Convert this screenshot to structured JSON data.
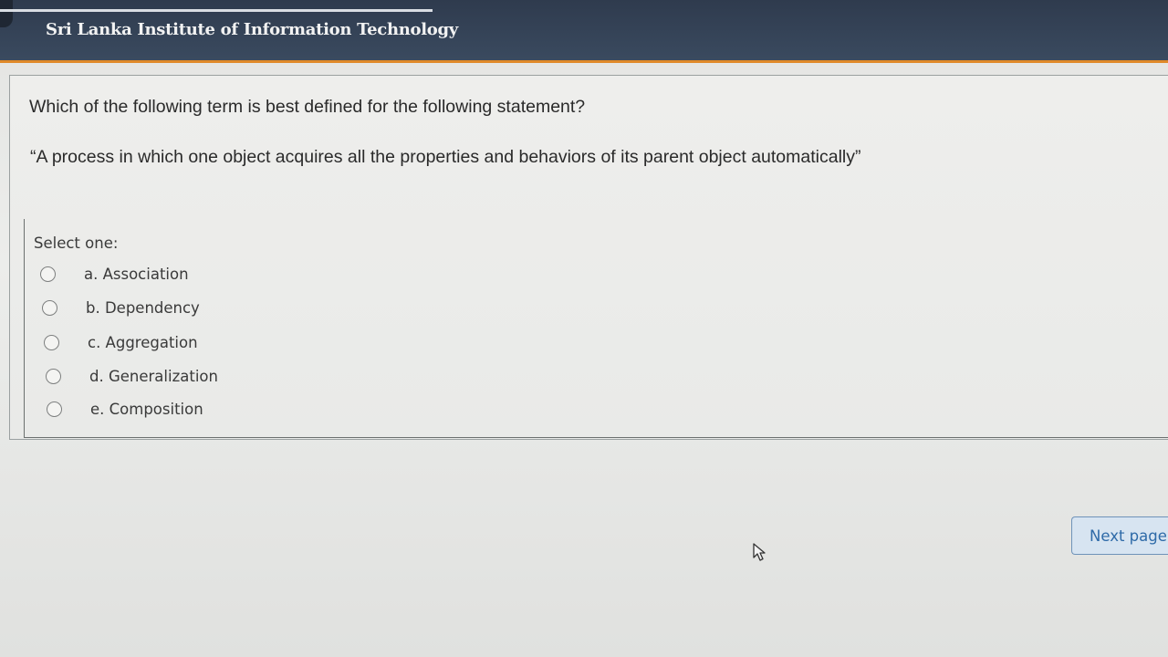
{
  "header": {
    "site_title": "Sri Lanka Institute of Information Technology"
  },
  "question": {
    "text": "Which of the following term is best defined for the following statement?",
    "statement": "“A process in which one object acquires all the properties and behaviors of its parent object automatically”",
    "prompt": "Select one:",
    "options": [
      {
        "label": "a. Association",
        "selected": false
      },
      {
        "label": "b. Dependency",
        "selected": false
      },
      {
        "label": "c. Aggregation",
        "selected": false
      },
      {
        "label": "d. Generalization",
        "selected": false
      },
      {
        "label": "e. Composition",
        "selected": false
      }
    ]
  },
  "navigation": {
    "next_label": "Next page"
  },
  "colors": {
    "header_bg": "#334052",
    "accent": "#e08a2a",
    "button_text": "#2e6aa8"
  },
  "icons": {
    "cursor": "mouse-pointer-icon"
  }
}
